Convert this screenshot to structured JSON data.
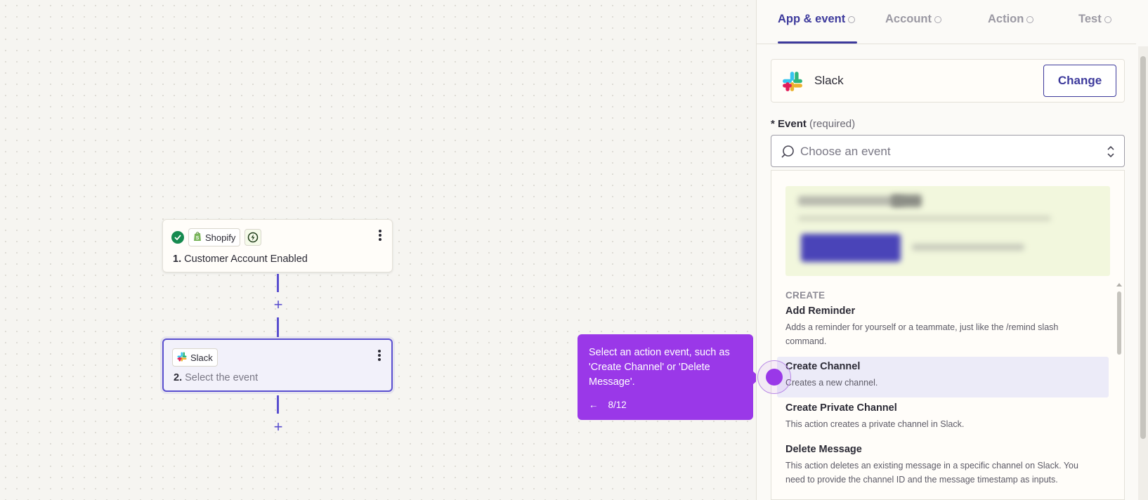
{
  "canvas": {
    "step1": {
      "app_label": "Shopify",
      "number": "1.",
      "title": "Customer Account Enabled"
    },
    "step2": {
      "app_label": "Slack",
      "number": "2.",
      "title": "Select the event"
    },
    "plus_label": "+"
  },
  "tooltip": {
    "message": "Select an action event, such as 'Create Channel' or 'Delete Message'.",
    "back_arrow": "←",
    "progress": "8/12"
  },
  "panel": {
    "tabs": [
      {
        "label": "App & event"
      },
      {
        "label": "Account"
      },
      {
        "label": "Action"
      },
      {
        "label": "Test"
      }
    ],
    "app_name": "Slack",
    "change_label": "Change",
    "event_label": {
      "asterisk": "*",
      "label": "Event",
      "required": "(required)"
    },
    "event_select": {
      "placeholder": "Choose an event"
    },
    "dropdown": {
      "section": "CREATE",
      "options": [
        {
          "title": "Add Reminder",
          "description": "Adds a reminder for yourself or a teammate, just like the /remind slash command."
        },
        {
          "title": "Create Channel",
          "description": "Creates a new channel."
        },
        {
          "title": "Create Private Channel",
          "description": "This action creates a private channel in Slack."
        },
        {
          "title": "Delete Message",
          "description": "This action deletes an existing message in a specific channel on Slack. You need to provide the channel ID and the message timestamp as inputs."
        }
      ]
    }
  },
  "colors": {
    "accent": "#3d3a9c",
    "tooltip": "#9a38e8",
    "success": "#168a4f",
    "highlight": "#ecebf8"
  },
  "icons": {
    "check": "check-circle-icon",
    "shopify": "shopify-logo-icon",
    "trigger": "instant-trigger-icon",
    "slack": "slack-logo-icon",
    "kebab": "more-vertical-icon",
    "search": "search-icon",
    "updown": "chevron-up-down-icon"
  }
}
